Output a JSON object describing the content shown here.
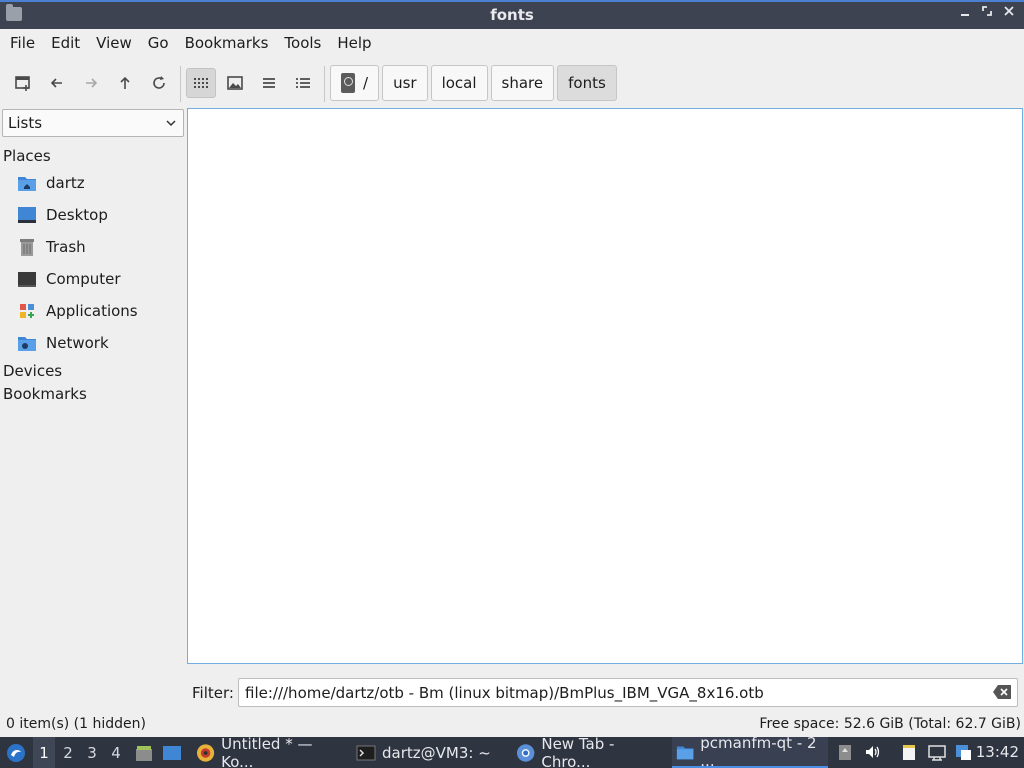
{
  "window": {
    "title": "fonts",
    "controls": [
      "minimize",
      "maximize",
      "close"
    ]
  },
  "menubar": {
    "items": [
      {
        "label": "File"
      },
      {
        "label": "Edit"
      },
      {
        "label": "View"
      },
      {
        "label": "Go"
      },
      {
        "label": "Bookmarks"
      },
      {
        "label": "Tools"
      },
      {
        "label": "Help"
      }
    ]
  },
  "toolbar": {
    "icons": [
      "new-tab-icon",
      "back-icon",
      "forward-icon",
      "up-icon",
      "reload-icon",
      "icon-view-icon",
      "thumbnail-view-icon",
      "compact-view-icon",
      "detailed-list-icon"
    ],
    "active_view": "icon-view"
  },
  "pathbar": {
    "segments": [
      "/",
      "usr",
      "local",
      "share",
      "fonts"
    ],
    "current": "fonts"
  },
  "sidepane": {
    "mode": "Lists",
    "places_header": "Places",
    "places": [
      {
        "label": "dartz",
        "icon": "home-folder-icon"
      },
      {
        "label": "Desktop",
        "icon": "desktop-icon"
      },
      {
        "label": "Trash",
        "icon": "trash-icon"
      },
      {
        "label": "Computer",
        "icon": "computer-icon"
      },
      {
        "label": "Applications",
        "icon": "applications-icon"
      },
      {
        "label": "Network",
        "icon": "network-folder-icon"
      }
    ],
    "devices_header": "Devices",
    "bookmarks_header": "Bookmarks"
  },
  "filter": {
    "label": "Filter:",
    "value": "file:///home/dartz/otb - Bm (linux bitmap)/BmPlus_IBM_VGA_8x16.otb"
  },
  "statusbar": {
    "left": "0 item(s) (1 hidden)",
    "right": "Free space: 52.6 GiB (Total: 62.7 GiB)"
  },
  "taskbar": {
    "workspaces": [
      "1",
      "2",
      "3",
      "4"
    ],
    "active_workspace": "1",
    "tasks": [
      {
        "label": "Untitled * — Ko...",
        "icon": "kolourpaint-icon"
      },
      {
        "label": "dartz@VM3: ~",
        "icon": "terminal-icon"
      },
      {
        "label": "New Tab - Chro...",
        "icon": "chromium-icon"
      },
      {
        "label": "pcmanfm-qt - 2 ...",
        "icon": "file-manager-icon",
        "active": true
      }
    ],
    "clock": "13:42"
  },
  "colors": {
    "accent": "#4b8ee6",
    "titlebar": "#3d4350",
    "taskbar": "#2f3441",
    "view_border": "#74aee0"
  }
}
